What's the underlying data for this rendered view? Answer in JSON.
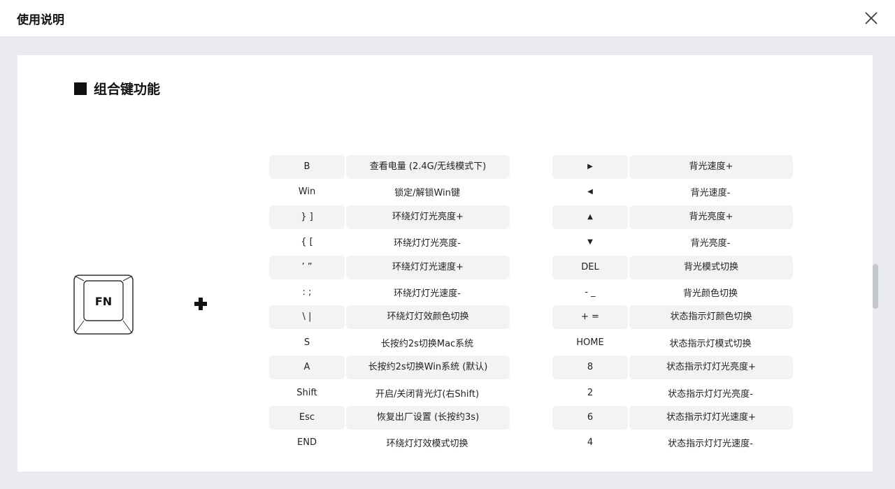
{
  "header": {
    "title": "使用说明"
  },
  "section": {
    "title": "组合键功能"
  },
  "fn_key": {
    "label": "FN"
  },
  "left_table": [
    {
      "key": "B",
      "desc": "查看电量 (2.4G/无线模式下)"
    },
    {
      "key": "Win",
      "desc": "锁定/解锁Win键"
    },
    {
      "key": "} ]",
      "desc": "环绕灯灯光亮度+"
    },
    {
      "key": "{ [",
      "desc": "环绕灯灯光亮度-"
    },
    {
      "key": "’ ”",
      "desc": "环绕灯灯光速度+"
    },
    {
      "key": ": ;",
      "desc": "环绕灯灯光速度-"
    },
    {
      "key": "\\ |",
      "desc": "环绕灯灯效颜色切换"
    },
    {
      "key": "S",
      "desc": "长按约2s切换Mac系统"
    },
    {
      "key": "A",
      "desc": "长按约2s切换Win系统 (默认)"
    },
    {
      "key": "Shift",
      "desc": "开启/关闭背光灯(右Shift)"
    },
    {
      "key": "Esc",
      "desc": "恢复出厂设置 (长按约3s)"
    },
    {
      "key": "END",
      "desc": "环绕灯灯效模式切换"
    }
  ],
  "right_table": [
    {
      "key": "▶",
      "desc": "背光速度+"
    },
    {
      "key": "◀",
      "desc": "背光速度-"
    },
    {
      "key": "▲",
      "desc": "背光亮度+"
    },
    {
      "key": "▼",
      "desc": "背光亮度-"
    },
    {
      "key": "DEL",
      "desc": "背光模式切换"
    },
    {
      "key": "- _",
      "desc": "背光颜色切换"
    },
    {
      "key": "+ =",
      "desc": "状态指示灯颜色切换"
    },
    {
      "key": "HOME",
      "desc": "状态指示灯模式切换"
    },
    {
      "key": "8",
      "desc": "状态指示灯灯光亮度+"
    },
    {
      "key": "2",
      "desc": "状态指示灯灯光亮度-"
    },
    {
      "key": "6",
      "desc": "状态指示灯灯光速度+"
    },
    {
      "key": "4",
      "desc": "状态指示灯灯光速度-"
    }
  ]
}
